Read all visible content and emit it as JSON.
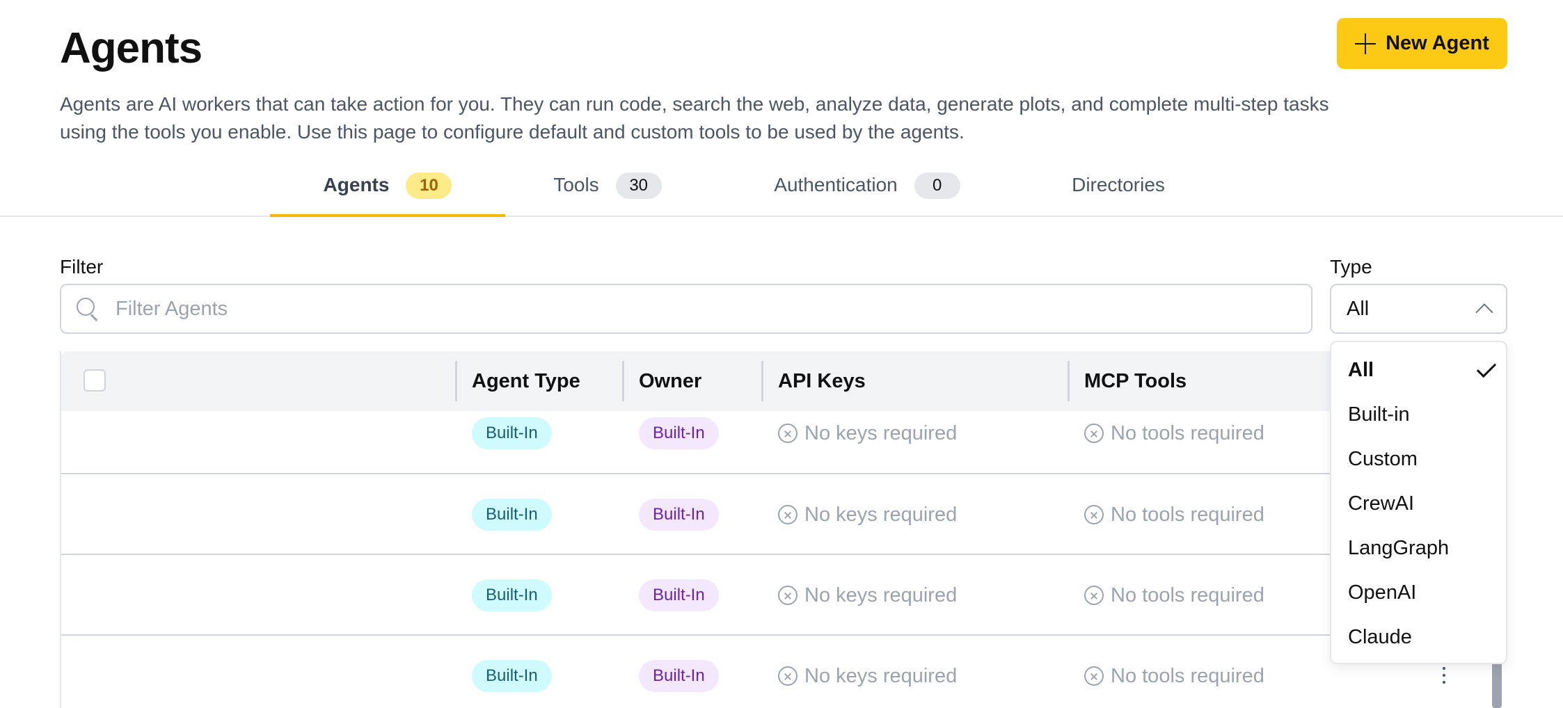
{
  "header": {
    "title": "Agents",
    "new_agent_label": "New Agent",
    "description": "Agents are AI workers that can take action for you. They can run code, search the web, analyze data, generate plots, and complete multi-step tasks using the tools you enable. Use this page to configure default and custom tools to be used by the agents."
  },
  "tabs": [
    {
      "label": "Agents",
      "count": "10"
    },
    {
      "label": "Tools",
      "count": "30"
    },
    {
      "label": "Authentication",
      "count": "0"
    },
    {
      "label": "Directories"
    }
  ],
  "filter": {
    "label": "Filter",
    "placeholder": "Filter Agents"
  },
  "type_filter": {
    "label": "Type",
    "selected": "All",
    "options": [
      "All",
      "Built-in",
      "Custom",
      "CrewAI",
      "LangGraph",
      "OpenAI",
      "Claude"
    ]
  },
  "table": {
    "columns": [
      "Agent Type",
      "Owner",
      "API Keys",
      "MCP Tools"
    ],
    "rows": [
      {
        "agent_type": "Built-In",
        "owner": "Built-In",
        "api_keys": "No keys required",
        "mcp_tools": "No tools required"
      },
      {
        "agent_type": "Built-In",
        "owner": "Built-In",
        "api_keys": "No keys required",
        "mcp_tools": "No tools required"
      },
      {
        "agent_type": "Built-In",
        "owner": "Built-In",
        "api_keys": "No keys required",
        "mcp_tools": "No tools required"
      },
      {
        "agent_type": "Built-In",
        "owner": "Built-In",
        "api_keys": "No keys required",
        "mcp_tools": "No tools required"
      }
    ]
  },
  "colors": {
    "accent": "#fcca15",
    "tab_underline": "#f2b705",
    "type_pill_bg": "#cffafe",
    "owner_pill_bg": "#f3e8ff"
  }
}
